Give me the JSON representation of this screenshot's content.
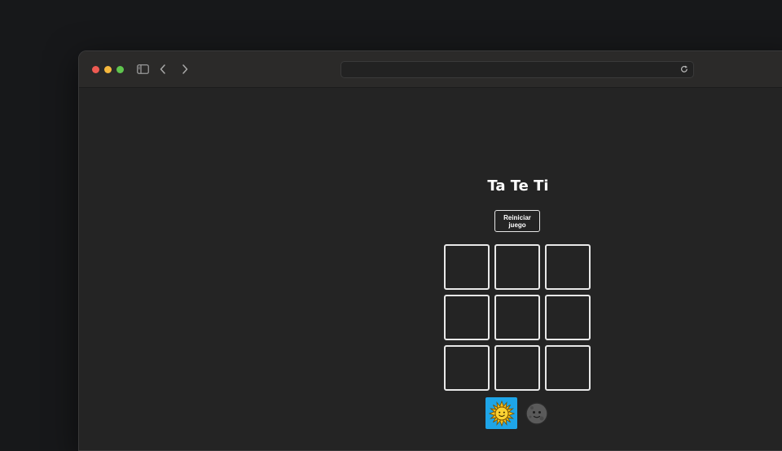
{
  "browser": {
    "address": "",
    "icons": [
      "sidebar-toggle-icon",
      "chevron-left-icon",
      "chevron-right-icon",
      "reload-icon"
    ]
  },
  "game": {
    "title": "Ta Te Ti",
    "reset_label": "Reiniciar juego",
    "board": [
      "",
      "",
      "",
      "",
      "",
      "",
      "",
      "",
      ""
    ],
    "players": [
      {
        "name": "sun",
        "icon": "sun-face-icon",
        "active": true
      },
      {
        "name": "moon",
        "icon": "new-moon-face-icon",
        "active": false
      }
    ],
    "active_color": "#1ea5e8"
  }
}
